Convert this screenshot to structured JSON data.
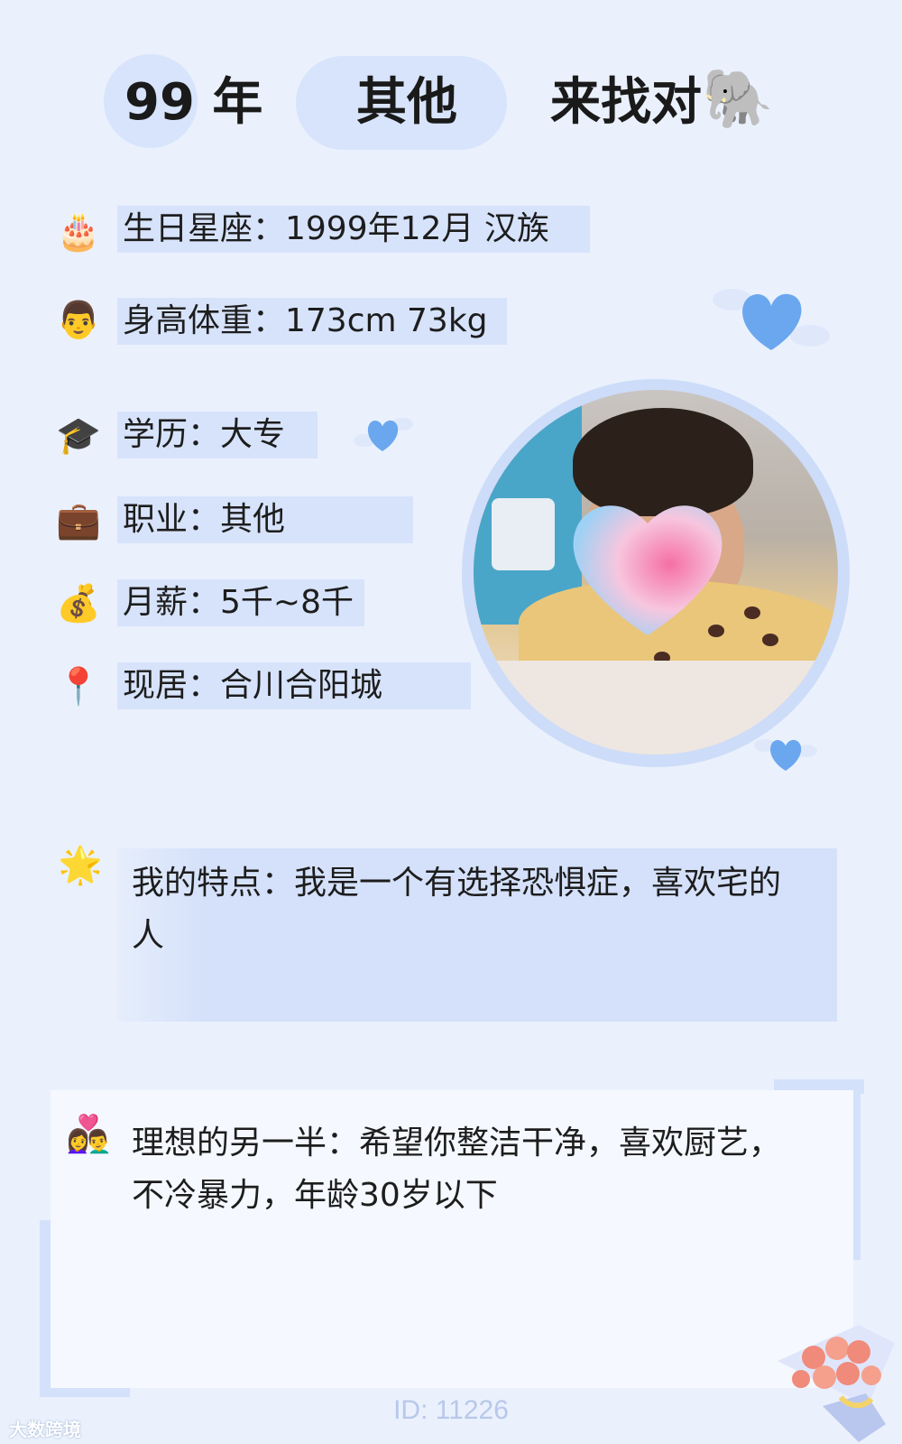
{
  "header": {
    "year": "99 年",
    "category": "其他",
    "seeking": "来找对",
    "seeking_emoji": "🐘"
  },
  "info": {
    "birthday": {
      "icon": "birthday-cake-icon",
      "emoji": "🎂",
      "text": "生日星座：1999年12月 汉族"
    },
    "height_weight": {
      "icon": "man-face-icon",
      "emoji": "👨",
      "text": "身高体重：173cm 73kg"
    },
    "education": {
      "icon": "graduation-cap-icon",
      "emoji": "🎓",
      "text": "学历：大专"
    },
    "occupation": {
      "icon": "briefcase-icon",
      "emoji": "💼",
      "text": "职业：其他"
    },
    "salary": {
      "icon": "money-bag-icon",
      "emoji": "💰",
      "text": "月薪：5千~8千"
    },
    "residence": {
      "icon": "location-pin-icon",
      "emoji": "📍",
      "text": "现居：合川合阳城"
    }
  },
  "features": {
    "icon": "star-icon",
    "emoji": "🌟",
    "text": "我的特点：我是一个有选择恐惧症，喜欢宅的人"
  },
  "ideal_partner": {
    "icon": "couple-heart-icon",
    "emoji": "👩‍❤️‍👨",
    "text": "理想的另一半：希望你整洁干净，喜欢厨艺，不冷暴力，年龄30岁以下"
  },
  "footer": {
    "id": "ID: 11226",
    "watermark": "大数跨境"
  },
  "colors": {
    "background": "#eaf1fd",
    "accent_bar": "#d7e3fb",
    "heart_blue": "#6aa7ef",
    "id_text": "#b8c8ea"
  }
}
